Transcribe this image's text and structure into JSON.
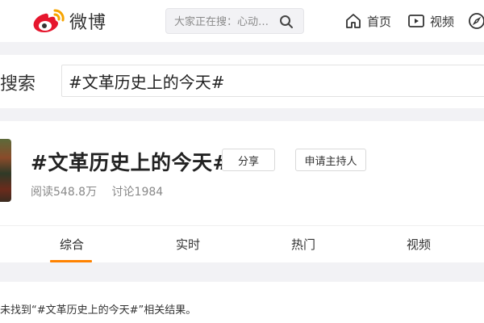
{
  "app": {
    "name": "微博"
  },
  "header": {
    "search_placeholder": "大家正在搜：心动…",
    "nav": [
      {
        "label": "首页",
        "icon": "home-icon"
      },
      {
        "label": "视频",
        "icon": "video-icon"
      },
      {
        "label": "",
        "icon": "compass-icon"
      }
    ]
  },
  "search": {
    "label": "搜索",
    "query": "#文革历史上的今天#"
  },
  "topic": {
    "title": "#文革历史上的今天#",
    "share_label": "分享",
    "host_label": "申请主持人",
    "read_count": "阅读548.8万",
    "discuss_count": "讨论1984"
  },
  "tabs": [
    {
      "label": "综合",
      "active": true
    },
    {
      "label": "实时",
      "active": false
    },
    {
      "label": "热门",
      "active": false
    },
    {
      "label": "视频",
      "active": false
    }
  ],
  "result": {
    "message": "未找到“#文革历史上的今天#”相关结果。"
  },
  "colors": {
    "accent": "#ff8200",
    "brand_red": "#e6162d",
    "background": "#f2f2f5"
  }
}
